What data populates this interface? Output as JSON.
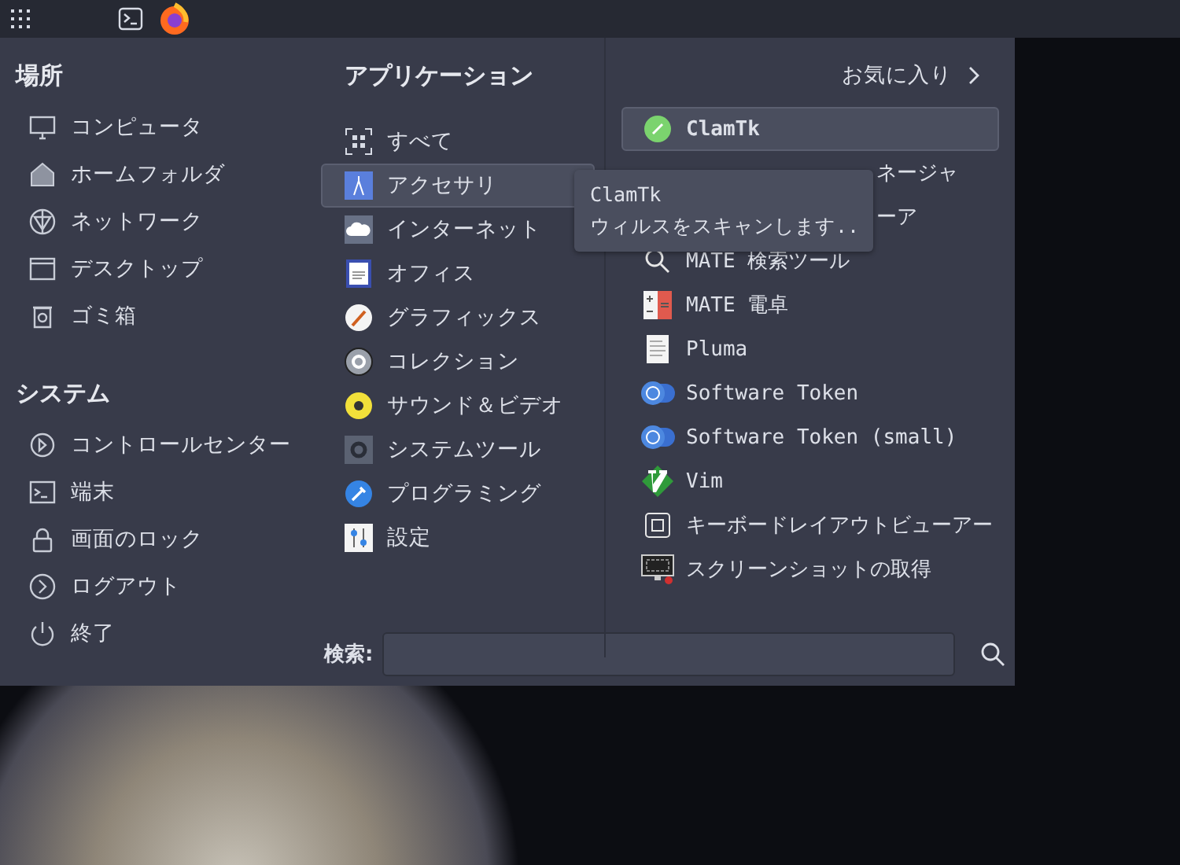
{
  "places": {
    "title": "場所",
    "items": [
      {
        "label": "コンピュータ"
      },
      {
        "label": "ホームフォルダ"
      },
      {
        "label": "ネットワーク"
      },
      {
        "label": "デスクトップ"
      },
      {
        "label": "ゴミ箱"
      }
    ]
  },
  "system": {
    "title": "システム",
    "items": [
      {
        "label": "コントロールセンター"
      },
      {
        "label": "端末"
      },
      {
        "label": "画面のロック"
      },
      {
        "label": "ログアウト"
      },
      {
        "label": "終了"
      }
    ]
  },
  "applications": {
    "title": "アプリケーション",
    "favorites_link": "お気に入り",
    "categories": [
      {
        "label": "すべて",
        "selected": false
      },
      {
        "label": "アクセサリ",
        "selected": true
      },
      {
        "label": "インターネット",
        "selected": false
      },
      {
        "label": "オフィス",
        "selected": false
      },
      {
        "label": "グラフィックス",
        "selected": false
      },
      {
        "label": "コレクション",
        "selected": false
      },
      {
        "label": "サウンド＆ビデオ",
        "selected": false
      },
      {
        "label": "システムツール",
        "selected": false
      },
      {
        "label": "プログラミング",
        "selected": false
      },
      {
        "label": "設定",
        "selected": false
      }
    ],
    "apps": [
      {
        "kind": "app",
        "label": "ClamTk",
        "selected": true
      },
      {
        "kind": "covered",
        "label": "ネージャ",
        "selected": false
      },
      {
        "kind": "covered",
        "label": "ーア",
        "selected": false
      },
      {
        "kind": "app",
        "label": "MATE 検索ツール",
        "selected": false
      },
      {
        "kind": "app",
        "label": "MATE 電卓",
        "selected": false
      },
      {
        "kind": "app",
        "label": "Pluma",
        "selected": false
      },
      {
        "kind": "app",
        "label": "Software Token",
        "selected": false
      },
      {
        "kind": "app",
        "label": "Software Token (small)",
        "selected": false
      },
      {
        "kind": "app",
        "label": "Vim",
        "selected": false
      },
      {
        "kind": "app",
        "label": "キーボードレイアウトビューアー",
        "selected": false
      },
      {
        "kind": "app",
        "label": "スクリーンショットの取得",
        "selected": false
      }
    ],
    "tooltip": {
      "title": "ClamTk",
      "text": "ウィルスをスキャンします.."
    }
  },
  "search": {
    "label": "検索:"
  }
}
